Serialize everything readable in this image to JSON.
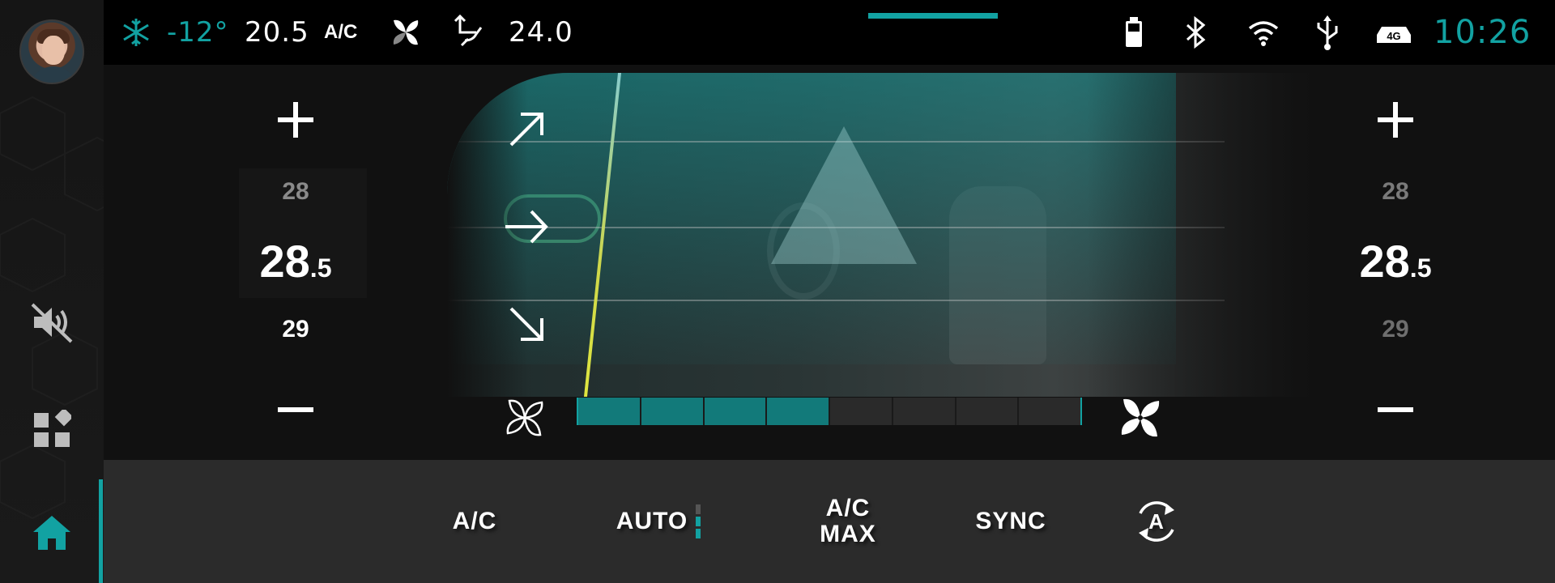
{
  "status_bar": {
    "outside_temp": "-12°",
    "driver_setpoint": "20.5",
    "ac_label": "A/C",
    "passenger_setpoint": "24.0",
    "time": "10:26",
    "network": "4G",
    "icons": [
      "snowflake-icon",
      "fan-icon",
      "airflow-icon",
      "battery-icon",
      "bluetooth-icon",
      "wifi-icon",
      "usb-icon",
      "cellular-4g-icon"
    ]
  },
  "sidebar": {
    "items": [
      {
        "name": "profile-avatar"
      },
      {
        "name": "mute-icon"
      },
      {
        "name": "apps-icon"
      },
      {
        "name": "home-icon",
        "active": true
      }
    ]
  },
  "climate": {
    "left_zone": {
      "upper": "28",
      "current_int": "28",
      "current_dec": ".5",
      "lower": "29"
    },
    "right_zone": {
      "upper": "28",
      "current_int": "28",
      "current_dec": ".5",
      "lower": "29"
    },
    "fan_speed": {
      "level": 4,
      "max": 8
    },
    "vents": [
      "windshield",
      "face",
      "feet"
    ]
  },
  "bottom_bar": {
    "ac": "A/C",
    "auto": "AUTO",
    "acmax_line1": "A/C",
    "acmax_line2": "MAX",
    "sync": "SYNC",
    "recirc_letter": "A"
  },
  "colors": {
    "accent": "#12a2a2",
    "panel": "#111111",
    "bottom": "#2b2b2b"
  }
}
